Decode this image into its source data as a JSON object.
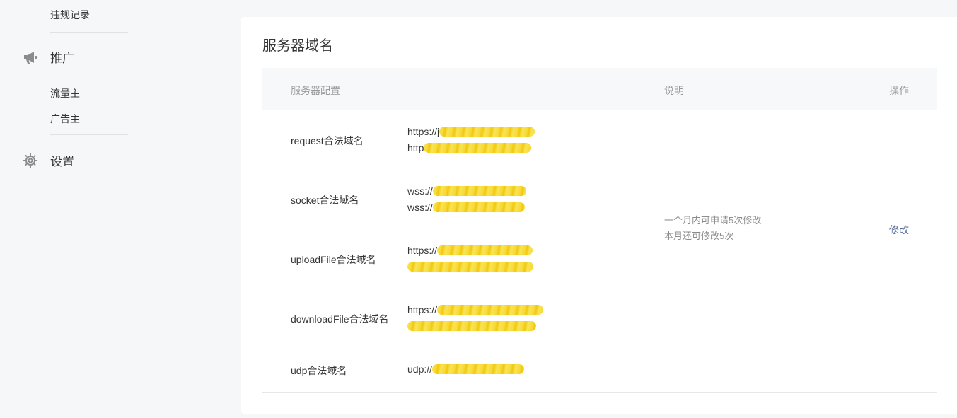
{
  "sidebar": {
    "violation_label": "违规记录",
    "promo": {
      "label": "推广",
      "icon": "megaphone-icon"
    },
    "promo_items": [
      "流量主",
      "广告主"
    ],
    "settings": {
      "label": "设置",
      "icon": "gear-icon"
    }
  },
  "card": {
    "title": "服务器域名",
    "headers": {
      "config": "服务器配置",
      "desc": "说明",
      "action": "操作"
    },
    "rows": [
      {
        "label": "request合法域名",
        "urls": [
          "https://j",
          "http"
        ]
      },
      {
        "label": "socket合法域名",
        "urls": [
          "wss://",
          "wss://"
        ]
      },
      {
        "label": "uploadFile合法域名",
        "urls": [
          "https://",
          ""
        ]
      },
      {
        "label": "downloadFile合法域名",
        "urls": [
          "https://",
          ""
        ]
      },
      {
        "label": "udp合法域名",
        "urls": [
          "udp://"
        ]
      }
    ],
    "notes": [
      "一个月内可申请5次修改",
      "本月还可修改5次"
    ],
    "action_label": "修改"
  }
}
